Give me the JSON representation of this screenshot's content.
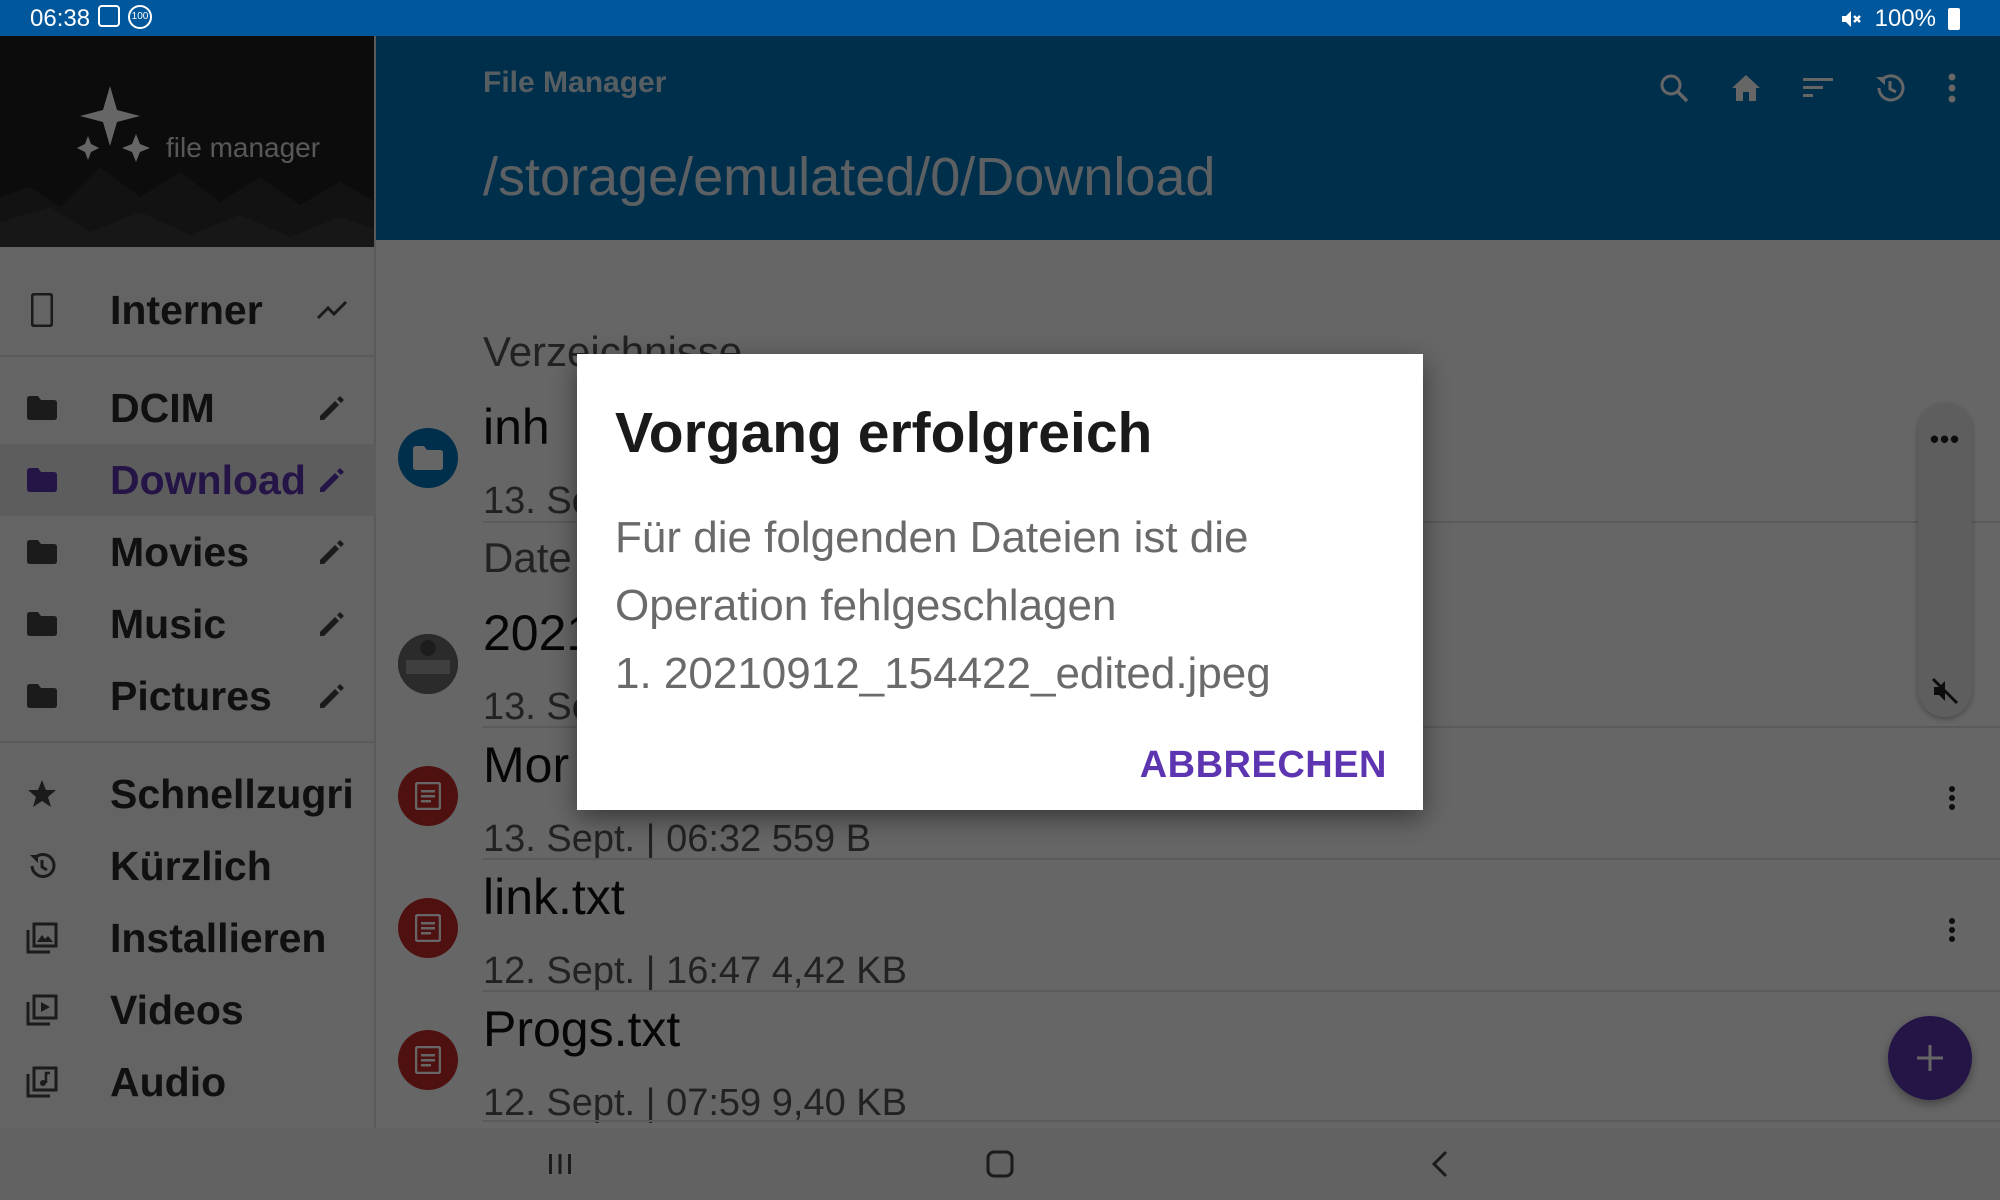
{
  "status_bar": {
    "time": "06:38",
    "battery": "100%",
    "badge": "100"
  },
  "drawer": {
    "app_subtitle": "file manager",
    "storage": {
      "label": "Interner"
    },
    "folders": [
      {
        "label": "DCIM"
      },
      {
        "label": "Download"
      },
      {
        "label": "Movies"
      },
      {
        "label": "Music"
      },
      {
        "label": "Pictures"
      }
    ],
    "library": [
      {
        "label": "Schnellzugri"
      },
      {
        "label": "Kürzlich"
      },
      {
        "label": "Installieren"
      },
      {
        "label": "Videos"
      },
      {
        "label": "Audio"
      }
    ]
  },
  "appbar": {
    "title": "File Manager",
    "path": "/storage/emulated/0/Download"
  },
  "content": {
    "sections": {
      "folders": "Verzeichnisse",
      "files": "Date"
    },
    "folder_rows": [
      {
        "name": "inh",
        "meta": "13. Se"
      }
    ],
    "file_rows": [
      {
        "name": "2021",
        "meta": "13. Se",
        "icon": "image-thumbnail"
      },
      {
        "name": "Mor",
        "meta": "13. Sept. | 06:32  559 B",
        "icon": "text-file-icon"
      },
      {
        "name": "link.txt",
        "meta": "12. Sept. | 16:47  4,42 KB",
        "icon": "text-file-icon"
      },
      {
        "name": "Progs.txt",
        "meta": "12. Sept. | 07:59  9,40 KB",
        "icon": "text-file-icon"
      }
    ]
  },
  "dialog": {
    "title": "Vorgang erfolgreich",
    "body_line1": "Für die folgenden Dateien ist die",
    "body_line2": "Operation fehlgeschlagen",
    "body_line3": "1. 20210912_154422_edited.jpeg",
    "button": "ABBRECHEN"
  },
  "colors": {
    "status_bar": "#01579b",
    "app_bar": "#0277bd",
    "accent": "#5e35b1",
    "folder_icon": "#0277bd",
    "text_file_icon": "#c62828"
  }
}
